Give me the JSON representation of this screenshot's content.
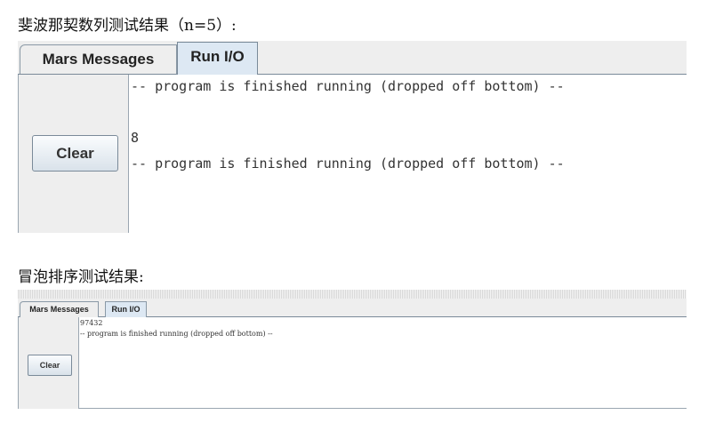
{
  "fib_section": {
    "heading": "斐波那契数列测试结果（n=5）:",
    "tabs": [
      "Mars Messages",
      "Run I/O"
    ],
    "active_tab": "Run I/O",
    "clear_label": "Clear",
    "output_lines": [
      "-- program is finished running (dropped off bottom) --",
      "8",
      "-- program is finished running (dropped off bottom) --"
    ]
  },
  "bubble_section": {
    "heading": "冒泡排序测试结果:",
    "tabs": [
      "Mars Messages",
      "Run I/O"
    ],
    "active_tab": "Run I/O",
    "clear_label": "Clear",
    "output_lines": [
      "97432",
      "-- program is finished running (dropped off bottom) --"
    ]
  }
}
